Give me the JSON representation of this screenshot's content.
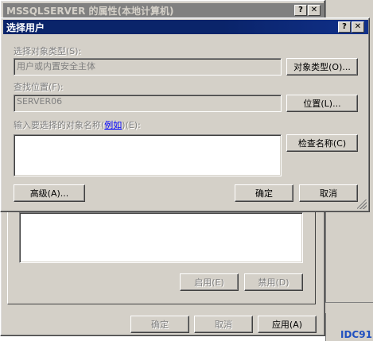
{
  "back_dialog": {
    "title": "MSSQLSERVER 的属性(本地计算机)",
    "help_glyph": "?",
    "close_glyph": "✕",
    "enable_button": "启用(E)",
    "disable_button": "禁用(D)",
    "ok_button": "确定",
    "cancel_button": "取消",
    "apply_button": "应用(A)"
  },
  "dialog": {
    "title": "选择用户",
    "help_glyph": "?",
    "close_glyph": "✕",
    "object_type_label": "选择对象类型(S):",
    "object_type_value": "用户或内置安全主体",
    "object_type_button": "对象类型(O)...",
    "location_label": "查找位置(F):",
    "location_value": "SERVER06",
    "location_button": "位置(L)...",
    "names_label": "输入要选择的对象名称(",
    "names_link": "例如",
    "names_label_suffix": ")(E):",
    "check_names_button": "检查名称(C)",
    "advanced_button": "高级(A)...",
    "ok_button": "确定",
    "cancel_button": "取消"
  },
  "watermark": "IDC91",
  "colors": {
    "active_title": "#0a246a",
    "inactive_title": "#808080",
    "face": "#d4d0c8",
    "link": "#0000ff"
  }
}
